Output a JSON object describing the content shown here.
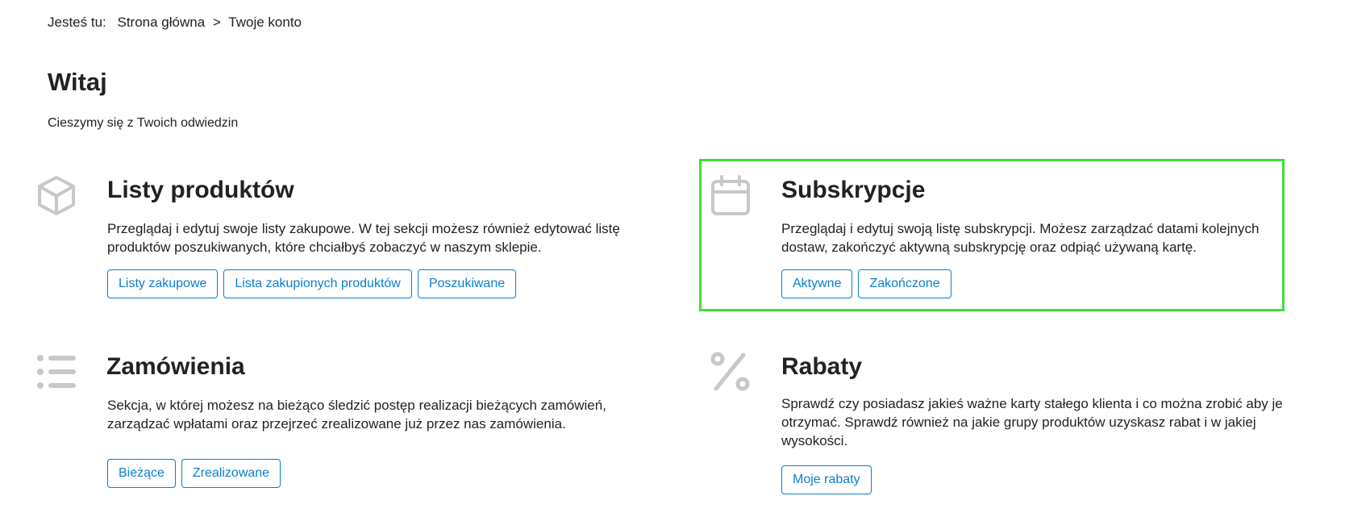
{
  "breadcrumb": {
    "label": "Jesteś tu:",
    "home": "Strona główna",
    "separator": ">",
    "current": "Twoje konto"
  },
  "page": {
    "title": "Witaj",
    "subtitle": "Cieszymy się z Twoich odwiedzin"
  },
  "sections": {
    "lists": {
      "icon": "box-icon",
      "title": "Listy produktów",
      "description": "Przeglądaj i edytuj swoje listy zakupowe. W tej sekcji możesz również edytować listę produktów poszukiwanych, które chciałbyś zobaczyć w naszym sklepie.",
      "buttons": [
        "Listy zakupowe",
        "Lista zakupionych produktów",
        "Poszukiwane"
      ]
    },
    "subscriptions": {
      "icon": "calendar-icon",
      "title": "Subskrypcje",
      "description": "Przeglądaj i edytuj swoją listę subskrypcji. Możesz zarządzać datami kolejnych dostaw, zakończyć aktywną subskrypcję oraz odpiąć używaną kartę.",
      "buttons": [
        "Aktywne",
        "Zakończone"
      ]
    },
    "orders": {
      "icon": "list-icon",
      "title": "Zamówienia",
      "description": "Sekcja, w której możesz na bieżąco śledzić postęp realizacji bieżących zamówień, zarządzać wpłatami oraz przejrzeć zrealizowane już przez nas zamówienia.",
      "buttons": [
        "Bieżące",
        "Zrealizowane"
      ]
    },
    "discounts": {
      "icon": "percent-icon",
      "title": "Rabaty",
      "description": "Sprawdź czy posiadasz jakieś ważne karty stałego klienta i co można zrobić aby je otrzymać. Sprawdź również na jakie grupy produktów uzyskasz rabat i w jakiej wysokości.",
      "buttons": [
        "Moje rabaty"
      ]
    }
  },
  "colors": {
    "accent": "#0a7fd1",
    "icon": "#c8c8c8",
    "highlight": "#3fe03a",
    "text": "#222222"
  }
}
